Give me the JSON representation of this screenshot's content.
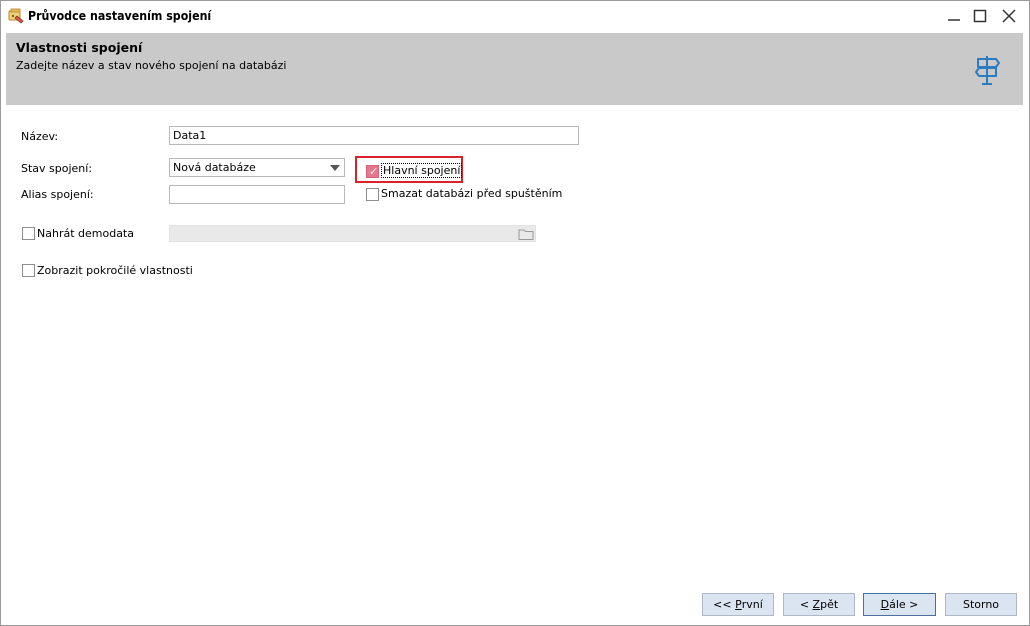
{
  "window": {
    "title": "Průvodce nastavením spojení"
  },
  "header": {
    "title": "Vlastnosti spojení",
    "subtitle": "Zadejte název a stav nového spojení na databázi",
    "icon": "signpost-icon"
  },
  "form": {
    "name_label": "Název:",
    "name_value": "Data1",
    "state_label": "Stav spojení:",
    "state_value": "Nová databáze",
    "alias_label": "Alias spojení:",
    "alias_value": "",
    "main_connection_label": "Hlavní spojení",
    "main_connection_checked": true,
    "delete_db_label": "Smazat databázi před spuštěním",
    "delete_db_checked": false,
    "load_demo_label": "Nahrát demodata",
    "load_demo_checked": false,
    "show_advanced_label": "Zobrazit pokročilé vlastnosti",
    "show_advanced_checked": false
  },
  "buttons": {
    "first_prefix": "<< ",
    "first_key": "P",
    "first_rest": "rvní",
    "back_prefix": "< ",
    "back_key": "Z",
    "back_rest": "pět",
    "next_key": "D",
    "next_rest": "ále >",
    "cancel": "Storno"
  },
  "colors": {
    "header_bg": "#c9c9c9",
    "accent": "#2a7bc0",
    "checkbox_checked": "#e7778e",
    "highlight": "#d9222a",
    "button_bg": "#dbe5f2"
  }
}
